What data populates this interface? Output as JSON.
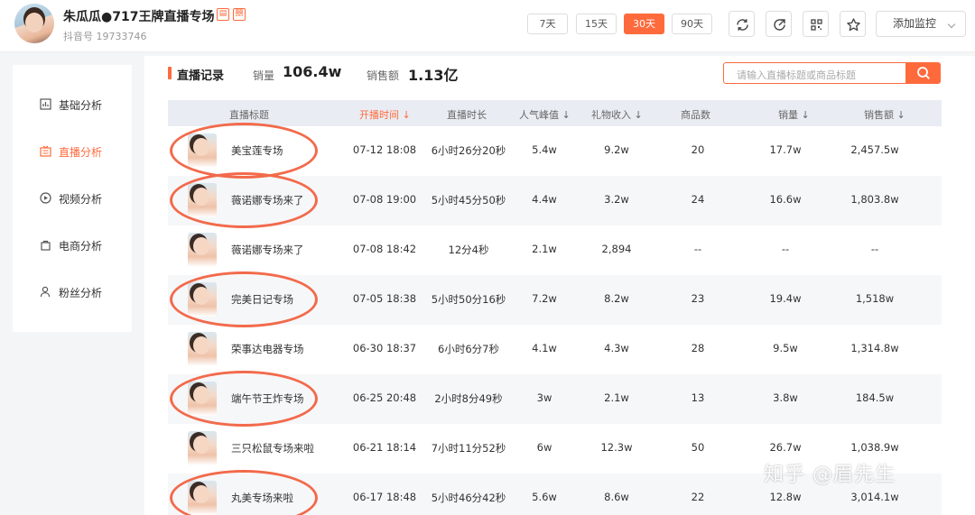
{
  "header": {
    "title": "朱瓜瓜●717王牌直播专场",
    "badge1": "📋",
    "badge2": "囍",
    "douyin_id": "抖音号 19733746",
    "ranges": [
      "7天",
      "15天",
      "30天",
      "90天"
    ],
    "active_range": "30天",
    "monitor_label": "添加监控"
  },
  "sidebar": {
    "items": [
      {
        "label": "基础分析",
        "icon": "chart-icon"
      },
      {
        "label": "直播分析",
        "icon": "live-icon",
        "active": true
      },
      {
        "label": "视频分析",
        "icon": "play-icon"
      },
      {
        "label": "电商分析",
        "icon": "bag-icon"
      },
      {
        "label": "粉丝分析",
        "icon": "user-icon"
      }
    ]
  },
  "main": {
    "section_title": "直播记录",
    "sales_label": "销量",
    "sales_value": "106.4w",
    "revenue_label": "销售额",
    "revenue_value": "1.13亿",
    "search_placeholder": "请输入直播标题或商品标题"
  },
  "table": {
    "headers": [
      "直播标题",
      "开播时间",
      "直播时长",
      "人气峰值",
      "礼物收入",
      "商品数",
      "销量",
      "销售额"
    ],
    "sort_marks": [
      "",
      "↓",
      "",
      "↓",
      "↓",
      "",
      "↓",
      "↓"
    ],
    "rows": [
      {
        "title": "美宝莲专场",
        "time": "07-12 18:08",
        "duration": "6小时26分20秒",
        "peak": "5.4w",
        "gift": "9.2w",
        "goods": "20",
        "sales": "17.7w",
        "revenue": "2,457.5w",
        "circled": true
      },
      {
        "title": "薇诺娜专场来了",
        "time": "07-08 19:00",
        "duration": "5小时45分50秒",
        "peak": "4.4w",
        "gift": "3.2w",
        "goods": "24",
        "sales": "16.6w",
        "revenue": "1,803.8w",
        "circled": true
      },
      {
        "title": "薇诺娜专场来了",
        "time": "07-08 18:42",
        "duration": "12分4秒",
        "peak": "2.1w",
        "gift": "2,894",
        "goods": "--",
        "sales": "--",
        "revenue": "--",
        "circled": false
      },
      {
        "title": "完美日记专场",
        "time": "07-05 18:38",
        "duration": "5小时50分16秒",
        "peak": "7.2w",
        "gift": "8.2w",
        "goods": "23",
        "sales": "19.4w",
        "revenue": "1,518w",
        "circled": true
      },
      {
        "title": "荣事达电器专场",
        "time": "06-30 18:37",
        "duration": "6小时6分7秒",
        "peak": "4.1w",
        "gift": "4.3w",
        "goods": "28",
        "sales": "9.5w",
        "revenue": "1,314.8w",
        "circled": false
      },
      {
        "title": "端午节王炸专场",
        "time": "06-25 20:48",
        "duration": "2小时8分49秒",
        "peak": "3w",
        "gift": "2.1w",
        "goods": "13",
        "sales": "3.8w",
        "revenue": "184.5w",
        "circled": true
      },
      {
        "title": "三只松鼠专场来啦",
        "time": "06-21 18:14",
        "duration": "7小时11分52秒",
        "peak": "6w",
        "gift": "12.3w",
        "goods": "50",
        "sales": "26.7w",
        "revenue": "1,038.9w",
        "circled": false
      },
      {
        "title": "丸美专场来啦",
        "time": "06-17 18:48",
        "duration": "5小时46分42秒",
        "peak": "5.6w",
        "gift": "8.6w",
        "goods": "22",
        "sales": "12.8w",
        "revenue": "3,014.1w",
        "circled": true
      }
    ]
  },
  "watermark": "知乎 @眉先生",
  "colors": {
    "accent": "#ff6a3d",
    "circle": "#f26a4b",
    "header_bg": "#e9edf3"
  }
}
